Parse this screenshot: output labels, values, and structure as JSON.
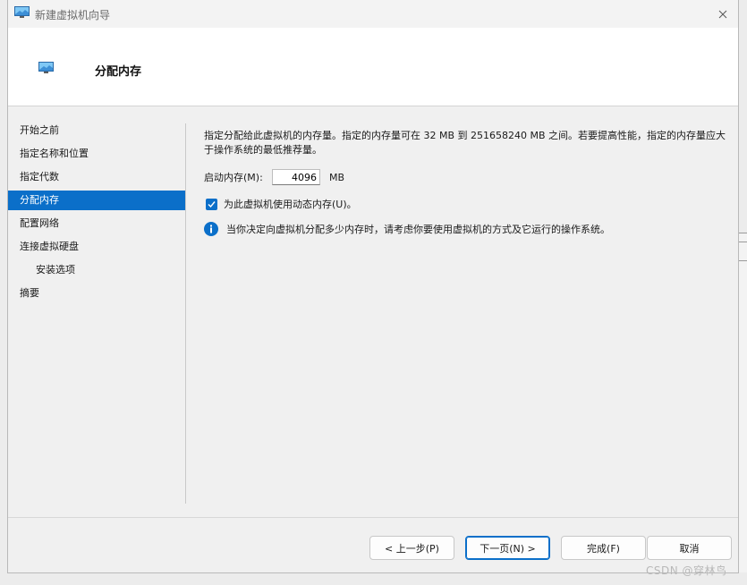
{
  "window": {
    "title": "新建虚拟机向导",
    "close_icon": "close-icon"
  },
  "header": {
    "title": "分配内存"
  },
  "nav": {
    "items": [
      {
        "label": "开始之前",
        "active": false,
        "sub": false
      },
      {
        "label": "指定名称和位置",
        "active": false,
        "sub": false
      },
      {
        "label": "指定代数",
        "active": false,
        "sub": false
      },
      {
        "label": "分配内存",
        "active": true,
        "sub": false
      },
      {
        "label": "配置网络",
        "active": false,
        "sub": false
      },
      {
        "label": "连接虚拟硬盘",
        "active": false,
        "sub": false
      },
      {
        "label": "安装选项",
        "active": false,
        "sub": true
      },
      {
        "label": "摘要",
        "active": false,
        "sub": false
      }
    ]
  },
  "content": {
    "description": "指定分配给此虚拟机的内存量。指定的内存量可在 32 MB 到 251658240 MB 之间。若要提高性能，指定的内存量应大于操作系统的最低推荐量。",
    "memory_label": "启动内存(M):",
    "memory_value": "4096",
    "memory_unit": "MB",
    "dynamic_memory_label": "为此虚拟机使用动态内存(U)。",
    "dynamic_memory_checked": true,
    "info_text": "当你决定向虚拟机分配多少内存时，请考虑你要使用虚拟机的方式及它运行的操作系统。"
  },
  "buttons": {
    "previous": "< 上一步(P)",
    "next": "下一页(N) >",
    "finish": "完成(F)",
    "cancel": "取消"
  },
  "watermark": "CSDN @穿林鸟",
  "colors": {
    "accent": "#0b6fc9",
    "info": "#0b6fc9"
  }
}
